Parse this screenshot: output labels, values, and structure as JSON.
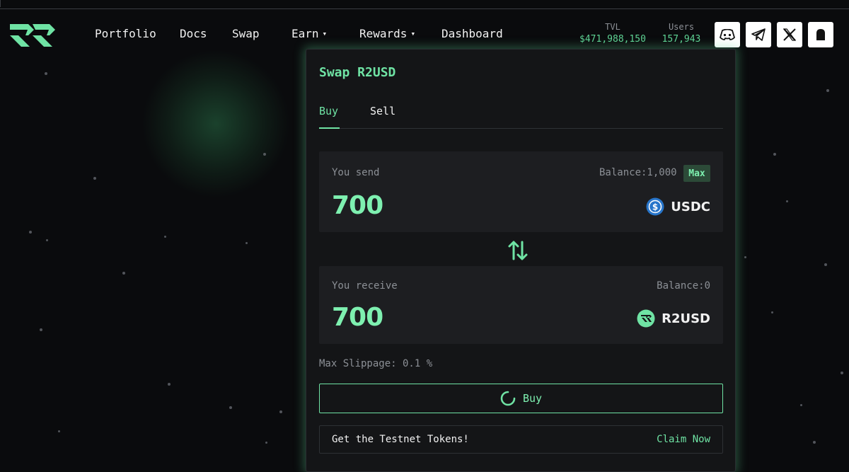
{
  "header": {
    "nav": [
      {
        "label": "Portfolio"
      },
      {
        "label": "Docs"
      },
      {
        "label": "Swap"
      },
      {
        "label": "Earn",
        "caret": "▾"
      },
      {
        "label": "Rewards",
        "caret": "▾"
      },
      {
        "label": "Dashboard"
      }
    ],
    "stats": {
      "tvl_label": "TVL",
      "tvl_value": "$471,988,150",
      "users_label": "Users",
      "users_value": "157,943"
    },
    "social_icons": [
      "discord-icon",
      "telegram-icon",
      "x-icon",
      "ghost-icon"
    ]
  },
  "swap": {
    "title": "Swap R2USD",
    "tabs": [
      "Buy",
      "Sell"
    ],
    "active_tab": "Buy",
    "send": {
      "label": "You send",
      "balance": "Balance:1,000",
      "max_label": "Max",
      "amount": "700",
      "token": "USDC",
      "token_icon": "usdc-icon"
    },
    "receive": {
      "label": "You receive",
      "balance": "Balance:0",
      "amount": "700",
      "token": "R2USD",
      "token_icon": "r2usd-icon"
    },
    "slippage": "Max Slippage: 0.1 %",
    "buy_label": "Buy",
    "testnet_text": "Get the Testnet Tokens!",
    "claim_label": "Claim Now"
  },
  "colors": {
    "accent": "#6fe3a4",
    "background": "#0a0b0d",
    "card": "#141517",
    "panel": "#1d1e21",
    "usdc_blue": "#2775ca"
  }
}
